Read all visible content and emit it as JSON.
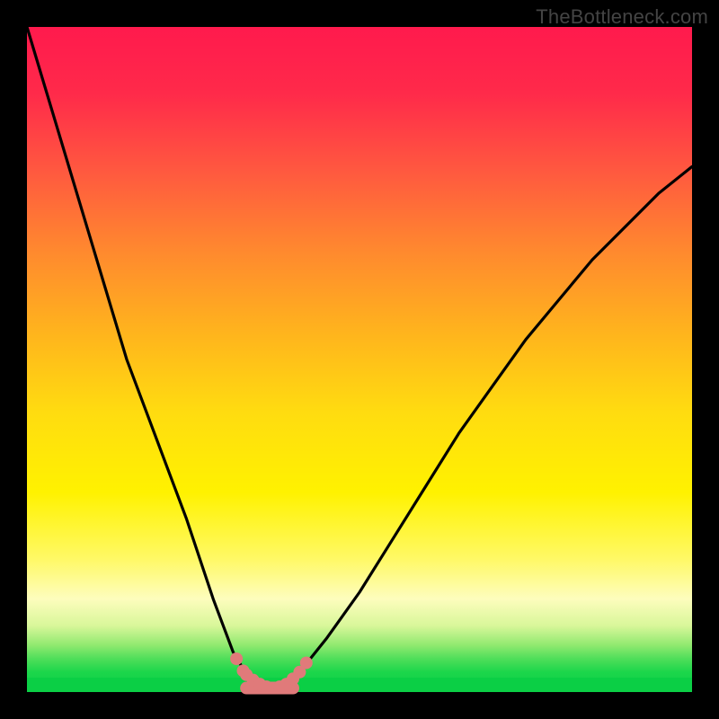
{
  "watermark": "TheBottleneck.com",
  "colors": {
    "frame": "#000000",
    "curve": "#000000",
    "marker": "#e07a7a",
    "gradient_top": "#ff1a4d",
    "gradient_bottom": "#0bcf45"
  },
  "chart_data": {
    "type": "line",
    "title": "",
    "xlabel": "",
    "ylabel": "",
    "xlim": [
      0,
      100
    ],
    "ylim": [
      0,
      100
    ],
    "grid": false,
    "legend": false,
    "description": "V-shaped bottleneck curve over a vertical red→yellow→green gradient; minimum (best match) sits near the bottom-green band where markers are drawn.",
    "x": [
      0,
      3,
      6,
      9,
      12,
      15,
      18,
      21,
      24,
      26,
      28,
      29.5,
      31,
      32.5,
      34,
      35,
      36,
      37,
      38,
      39,
      41,
      45,
      50,
      55,
      60,
      65,
      70,
      75,
      80,
      85,
      90,
      95,
      100
    ],
    "y": [
      100,
      90,
      80,
      70,
      60,
      50,
      42,
      34,
      26,
      20,
      14,
      10,
      6,
      3.5,
      2,
      1.2,
      0.8,
      0.6,
      0.8,
      1.5,
      3,
      8,
      15,
      23,
      31,
      39,
      46,
      53,
      59,
      65,
      70,
      75,
      79
    ],
    "series": [
      {
        "name": "bottleneck-curve",
        "x": [
          0,
          3,
          6,
          9,
          12,
          15,
          18,
          21,
          24,
          26,
          28,
          29.5,
          31,
          32.5,
          34,
          35,
          36,
          37,
          38,
          39,
          41,
          45,
          50,
          55,
          60,
          65,
          70,
          75,
          80,
          85,
          90,
          95,
          100
        ],
        "y": [
          100,
          90,
          80,
          70,
          60,
          50,
          42,
          34,
          26,
          20,
          14,
          10,
          6,
          3.5,
          2,
          1.2,
          0.8,
          0.6,
          0.8,
          1.5,
          3,
          8,
          15,
          23,
          31,
          39,
          46,
          53,
          59,
          65,
          70,
          75,
          79
        ]
      }
    ],
    "markers": {
      "name": "near-optimal-points",
      "x": [
        31.5,
        32.5,
        33,
        34,
        35,
        36,
        37,
        38,
        39,
        40,
        41,
        42
      ],
      "y": [
        5,
        3.2,
        2.6,
        1.8,
        1.2,
        0.8,
        0.6,
        0.8,
        1.2,
        2.0,
        3.0,
        4.4
      ]
    },
    "flat_segment": {
      "name": "valley-flat",
      "x_start": 33,
      "x_end": 40,
      "y": 0.6
    },
    "optimum_x": 37
  }
}
